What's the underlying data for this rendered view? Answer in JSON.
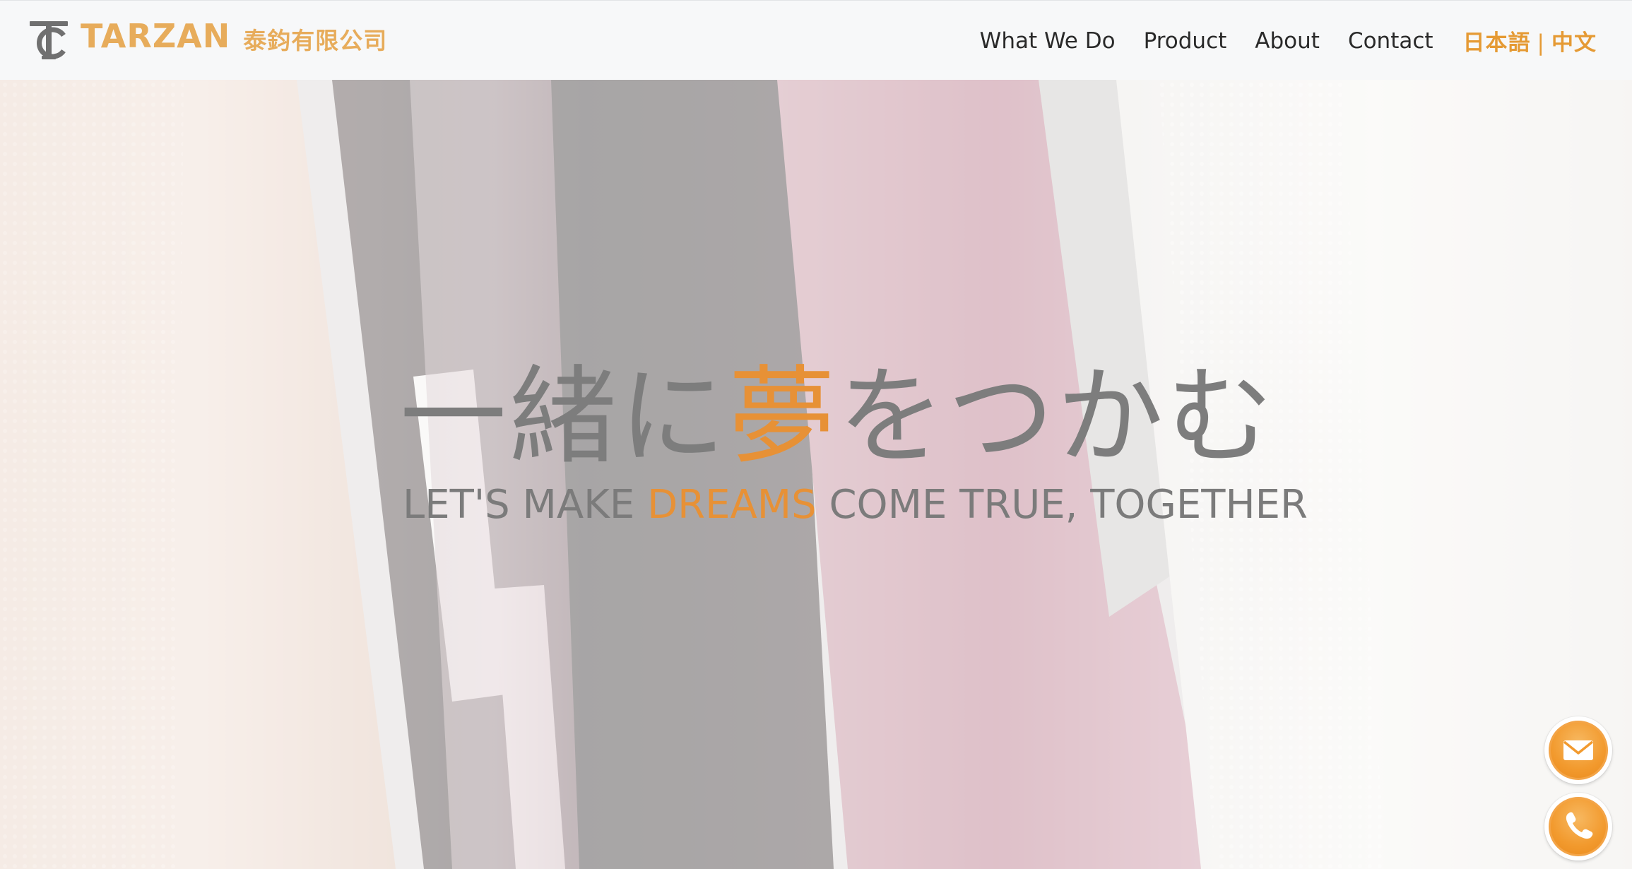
{
  "header": {
    "brand_name": "TARZAN",
    "brand_subtitle": "泰鈞有限公司",
    "nav": {
      "what_we_do": "What We Do",
      "product": "Product",
      "about": "About",
      "contact": "Contact"
    },
    "languages": {
      "japanese": "日本語",
      "separator": "|",
      "chinese": "中文"
    }
  },
  "hero": {
    "headline_before": "一緒に",
    "headline_accent": "夢",
    "headline_after": "をつかむ",
    "tagline_before": "LET'S MAKE ",
    "tagline_accent": "DREAMS",
    "tagline_after": " COME TRUE, TOGETHER"
  },
  "floating_actions": {
    "email_icon": "envelope-icon",
    "phone_icon": "phone-icon"
  },
  "colors": {
    "brand": "#e7ac5b",
    "accent": "#e79136",
    "nav_text": "#2a2a2a",
    "headline_text": "#7d7d7d",
    "header_bg": "#f7f8f9"
  }
}
